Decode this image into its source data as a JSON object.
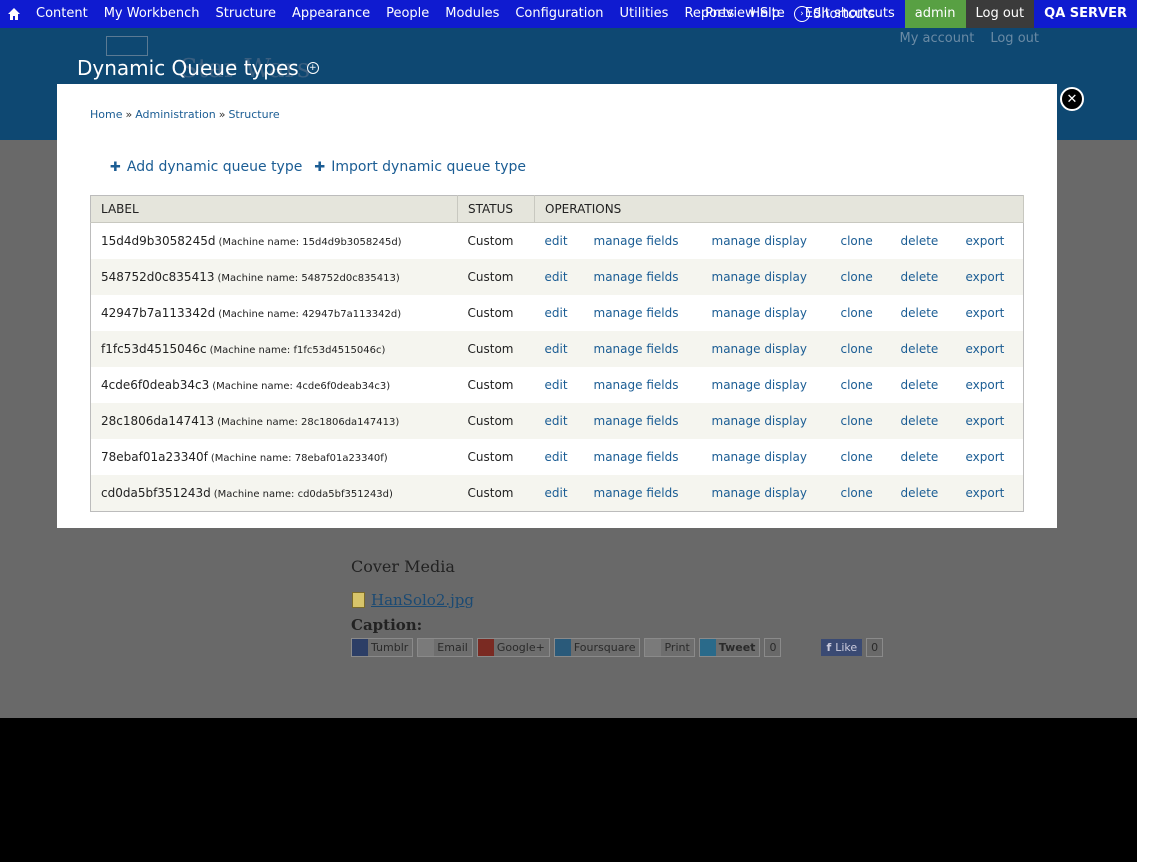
{
  "toolbar": {
    "items": [
      "Content",
      "My Workbench",
      "Structure",
      "Appearance",
      "People",
      "Modules",
      "Configuration",
      "Utilities",
      "Reports",
      "Help"
    ],
    "shortcuts": "Shortcuts",
    "preview_site": "Preview Site",
    "edit_shortcuts": "Edit shortcuts",
    "admin": "admin",
    "logout": "Log out",
    "server": "QA SERVER"
  },
  "header": {
    "site_name": "Star Wars",
    "my_account": "My account",
    "log_out": "Log out",
    "page_title": "Dynamic Queue types"
  },
  "background": {
    "cover_heading": "Cover Media",
    "file_name": "HanSolo2.jpg",
    "caption": "Caption:",
    "share": [
      "Tumblr",
      "Email",
      "Google+",
      "Foursquare",
      "Print",
      "Tweet"
    ],
    "tweet_count": "0",
    "like": "Like",
    "like_count": "0"
  },
  "modal": {
    "breadcrumb": [
      "Home",
      "Administration",
      "Structure"
    ],
    "actions": [
      "Add dynamic queue type",
      "Import dynamic queue type"
    ],
    "columns": [
      "LABEL",
      "STATUS",
      "OPERATIONS"
    ],
    "operations": [
      "edit",
      "manage fields",
      "manage display",
      "clone",
      "delete",
      "export"
    ],
    "rows": [
      {
        "label": "15d4d9b3058245d",
        "machine": "(Machine name: 15d4d9b3058245d)",
        "status": "Custom"
      },
      {
        "label": "548752d0c835413",
        "machine": "(Machine name: 548752d0c835413)",
        "status": "Custom"
      },
      {
        "label": "42947b7a113342d",
        "machine": "(Machine name: 42947b7a113342d)",
        "status": "Custom"
      },
      {
        "label": "f1fc53d4515046c",
        "machine": "(Machine name: f1fc53d4515046c)",
        "status": "Custom"
      },
      {
        "label": "4cde6f0deab34c3",
        "machine": "(Machine name: 4cde6f0deab34c3)",
        "status": "Custom"
      },
      {
        "label": "28c1806da147413",
        "machine": "(Machine name: 28c1806da147413)",
        "status": "Custom"
      },
      {
        "label": "78ebaf01a23340f",
        "machine": "(Machine name: 78ebaf01a23340f)",
        "status": "Custom"
      },
      {
        "label": "cd0da5bf351243d",
        "machine": "(Machine name: cd0da5bf351243d)",
        "status": "Custom"
      }
    ]
  }
}
